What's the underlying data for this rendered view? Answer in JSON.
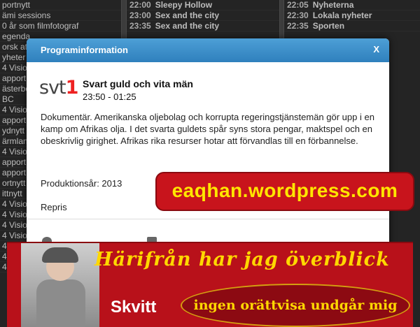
{
  "schedule": {
    "col_a": [
      "portnytt",
      "ämi sessions",
      "0 år som filmfotograf",
      "egenda",
      "orsk at",
      "yheter",
      "4 Visio",
      "apport",
      "ästerbo",
      "BC",
      "4 Visio",
      "apport",
      "ydnytt",
      "ärmlan",
      "4 Visio",
      "apport",
      "apport",
      "ortnytt",
      "ittnytt",
      "4 Visio",
      "4 Visio",
      "4 Visio",
      "4 Visio",
      "4 Visio",
      "4 Visio",
      "4 Visio"
    ],
    "col_b": [
      {
        "time": "22:00",
        "name": "Sleepy Hollow"
      },
      {
        "time": "23:00",
        "name": "Sex and the city"
      },
      {
        "time": "23:35",
        "name": "Sex and the city"
      }
    ],
    "col_c": [
      {
        "time": "22:05",
        "name": "Nyheterna"
      },
      {
        "time": "22:30",
        "name": "Lokala nyheter"
      },
      {
        "time": "22:35",
        "name": "Sporten"
      }
    ]
  },
  "modal": {
    "title": "Programinformation",
    "close_label": "X",
    "channel_logo_text": "svt",
    "channel_logo_number": "1",
    "program_title": "Svart guld och vita män",
    "time_range": "23:50 - 01:25",
    "description": "Dokumentär. Amerikanska oljebolag och korrupta regeringstjänstemän gör upp i en kamp om Afrikas olja. I det svarta guldets spår syns stora pengar, maktspel och en obeskrivlig girighet. Afrikas rika resurser hotar att förvandlas till en förbannelse.",
    "production_year": "Produktionsår: 2013",
    "repris": "Repris"
  },
  "watermark": {
    "text": "eaqhan.wordpress.com"
  },
  "ad": {
    "headline": "Härifrån har jag överblick",
    "name": "Skvitt",
    "tagline": "ingen orättvisa undgår mig"
  }
}
